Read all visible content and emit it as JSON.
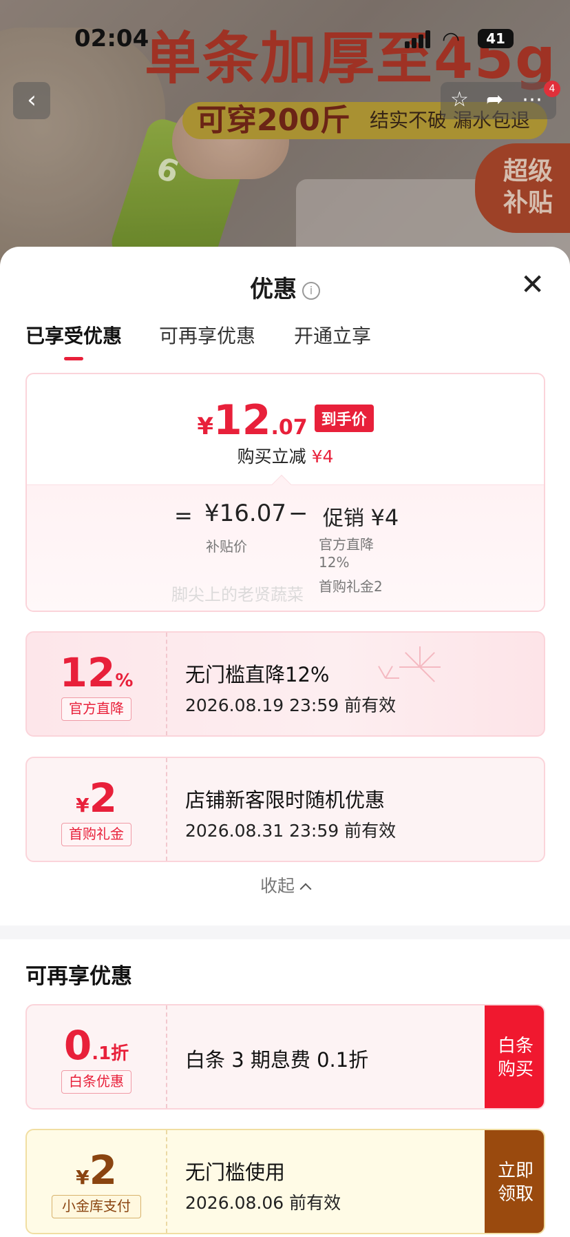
{
  "status_bar": {
    "time": "02:04",
    "battery": "41"
  },
  "banner": {
    "headline": "单条加厚至45g",
    "sub_big": "可穿200斤",
    "sub_small": "结实不破 漏水包退",
    "badge": "超级补贴",
    "pouch_number": "6",
    "cart_badge": "4"
  },
  "sheet": {
    "title": "优惠",
    "tabs": [
      "已享受优惠",
      "可再享优惠",
      "开通立享"
    ],
    "summary": {
      "yen": "¥",
      "price_int": "12",
      "price_dec": ".07",
      "price_tag": "到手价",
      "reduce_text": "购买立减",
      "reduce_amount": "¥4",
      "equals": "=",
      "base_price": "¥16.07",
      "base_label": "补贴价",
      "minus": "−",
      "promo_label": "促销",
      "promo_amount": "¥4",
      "promo_detail_1": "官方直降12%",
      "promo_detail_2": "首购礼金2",
      "watermark": "脚尖上的老贤蔬菜"
    },
    "enjoyed_coupons": [
      {
        "value": "12",
        "unit": "%",
        "label": "官方直降",
        "title": "无门槛直降12%",
        "validity": "2026.08.19 23:59 前有效"
      },
      {
        "prefix": "¥",
        "value": "2",
        "label": "首购礼金",
        "title": "店铺新客限时随机优惠",
        "validity": "2026.08.31 23:59 前有效"
      }
    ],
    "collapse_label": "收起",
    "more_section_title": "可再享优惠",
    "more_coupons": [
      {
        "value": "0",
        "unit": ".1折",
        "label": "白条优惠",
        "title": "白条 3 期息费 0.1折",
        "cta": "白条购买"
      },
      {
        "prefix": "¥",
        "value": "2",
        "label": "小金库支付",
        "title": "无门槛使用",
        "validity": "2026.08.06 前有效",
        "cta": "立即领取"
      }
    ]
  }
}
